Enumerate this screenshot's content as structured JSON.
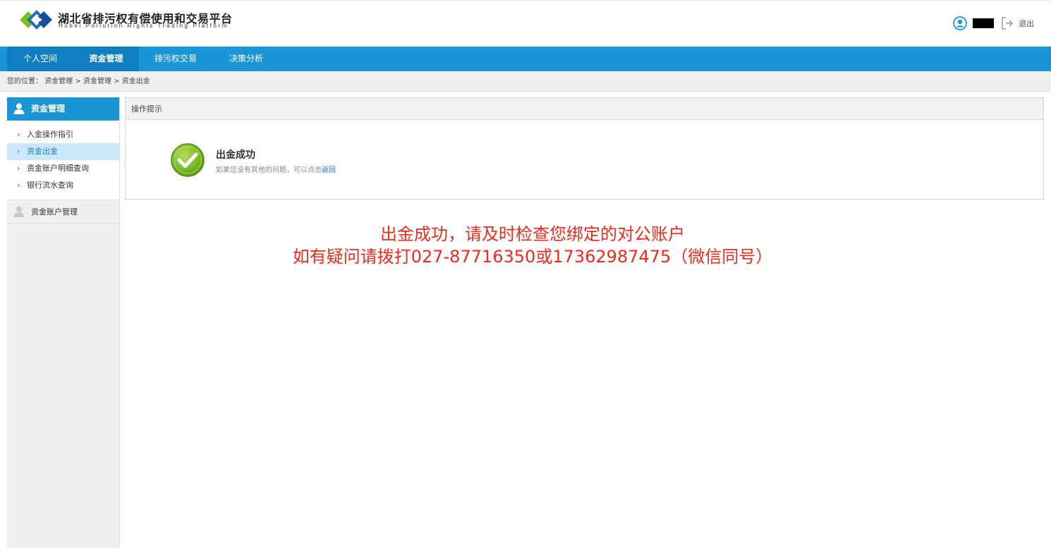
{
  "header": {
    "title": "湖北省排污权有偿使用和交易平台",
    "subtitle": "Hubei Pollution Rights Trading Platform",
    "logout_label": "退出"
  },
  "nav": {
    "items": [
      {
        "label": "个人空间"
      },
      {
        "label": "资金管理"
      },
      {
        "label": "排污权交易"
      },
      {
        "label": "决策分析"
      }
    ]
  },
  "breadcrumb": {
    "prefix": "您的位置：",
    "items": [
      "资金管理",
      "资金管理",
      "资金出金"
    ],
    "separator": ">"
  },
  "sidebar": {
    "group1_title": "资金管理",
    "items": [
      {
        "label": "入金操作指引"
      },
      {
        "label": "资金出金"
      },
      {
        "label": "资金账户明细查询"
      },
      {
        "label": "银行流水查询"
      }
    ],
    "group2_title": "资金账户管理"
  },
  "panel": {
    "header": "操作提示",
    "success_title": "出金成功",
    "success_desc": "如果您没有其他的问题，可以点击",
    "return_link": "返回"
  },
  "notice": {
    "line1": "出金成功，请及时检查您绑定的对公账户",
    "line2": "如有疑问请拨打027-87716350或17362987475（微信同号）"
  },
  "colors": {
    "nav_blue": "#1a95d6",
    "nav_active": "#0f7fc2",
    "notice_red": "#ee2a1b",
    "success_green": "#7cbf1e"
  }
}
